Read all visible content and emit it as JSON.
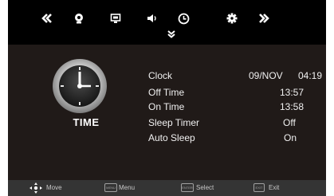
{
  "tabs": [
    {
      "name": "tab-back",
      "icon": "double-chevron-left-icon"
    },
    {
      "name": "tab-picture",
      "icon": "picture-icon"
    },
    {
      "name": "tab-display",
      "icon": "display-icon"
    },
    {
      "name": "tab-sound",
      "icon": "speaker-icon"
    },
    {
      "name": "tab-time",
      "icon": "clock-icon"
    },
    {
      "name": "tab-setup",
      "icon": "gear-icon"
    },
    {
      "name": "tab-forward",
      "icon": "double-chevron-right-icon"
    }
  ],
  "page": {
    "title": "TIME"
  },
  "settings": [
    {
      "label": "Clock",
      "value": "09/NOV",
      "value2": "04:19"
    },
    {
      "label": "Off Time",
      "value": "13:57"
    },
    {
      "label": "On Time",
      "value": "13:58"
    },
    {
      "label": "Sleep Timer",
      "value": "Off"
    },
    {
      "label": "Auto Sleep",
      "value": "On"
    }
  ],
  "footer": {
    "move": "Move",
    "menu_key": "MENU",
    "menu": "Menu",
    "enter_key": "ENTER",
    "select": "Select",
    "exit_key": "EXIT",
    "exit": "Exit"
  },
  "colors": {
    "background": "#201a18",
    "topbar": "#000000",
    "bottombar": "#343434",
    "text": "#f0f0f0"
  }
}
